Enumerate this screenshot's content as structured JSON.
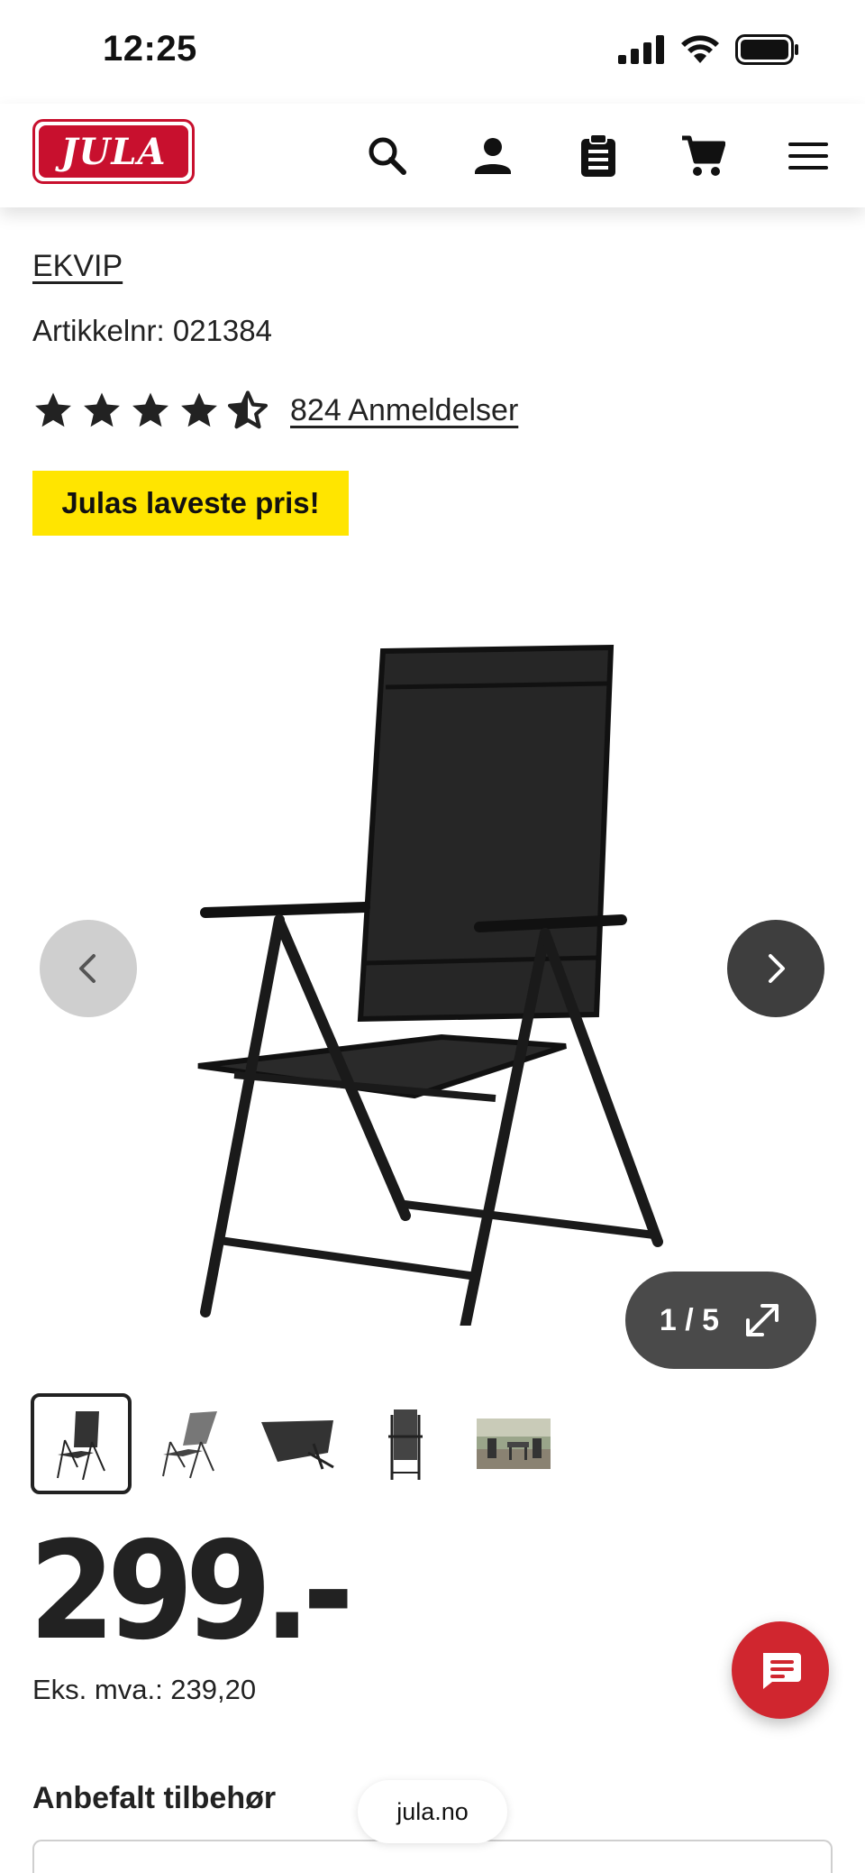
{
  "status_bar": {
    "time": "12:25"
  },
  "header": {
    "logo_text": "JULA",
    "icons": [
      "search-icon",
      "user-icon",
      "clipboard-list-icon",
      "cart-icon",
      "menu-icon"
    ]
  },
  "product": {
    "brand": "EKVIP",
    "article_number": "Artikkelnr: 021384",
    "rating": 4.5,
    "reviews_label": "824 Anmeldelser",
    "promo_badge": "Julas laveste pris!",
    "price": "299.-",
    "ex_vat": "Eks. mva.: 239,20"
  },
  "gallery": {
    "counter": "1 / 5",
    "thumbnails": [
      "chair-front",
      "chair-reclined",
      "chair-folded-flat",
      "chair-folded",
      "chair-set-outdoor"
    ],
    "active_index": 0
  },
  "sections": {
    "recommended_accessories": "Anbefalt tilbehør"
  },
  "browser": {
    "url": "jula.no"
  },
  "colors": {
    "brand_red": "#c8102e",
    "promo_yellow": "#ffe500",
    "chat_red": "#d0262f"
  }
}
